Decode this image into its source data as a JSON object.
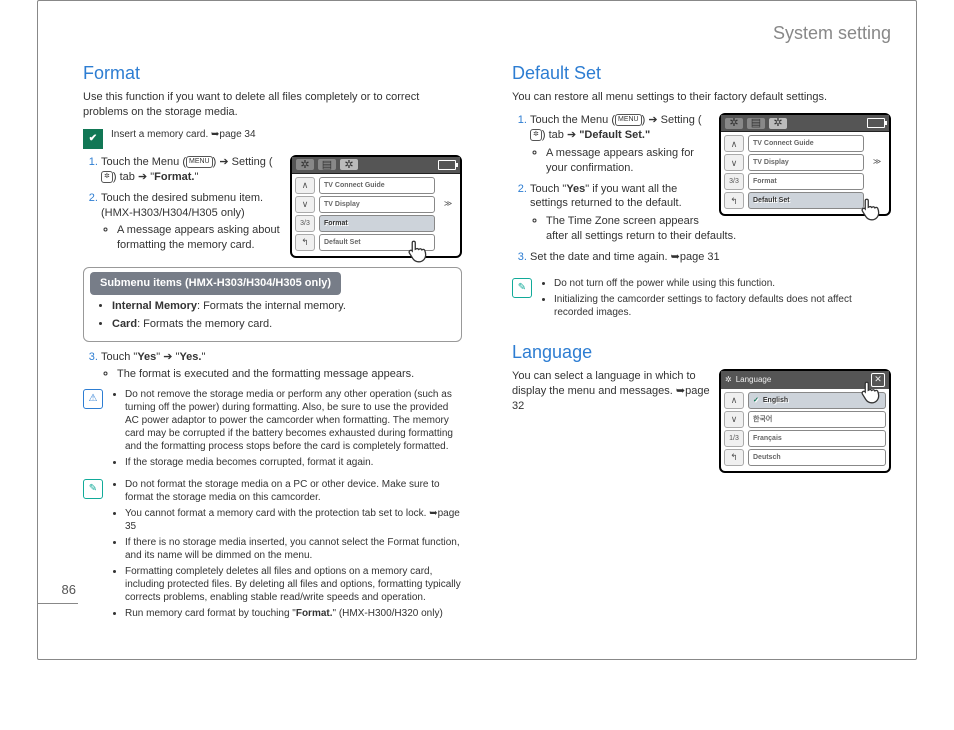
{
  "chapter_title": "System setting",
  "page_number": "86",
  "left": {
    "heading": "Format",
    "intro": "Use this function if you want to delete all files completely or to correct problems on the storage media.",
    "insert_card_note": "Insert a memory card. ➥page 34",
    "step1_a": "Touch the Menu (",
    "step1_b": ") ➔ Setting (",
    "step1_c": ") tab ➔ \"",
    "step1_bold": "Format.",
    "step1_d": "\"",
    "step2_a": "Touch the desired submenu item. (HMX-H303/H304/H305 only)",
    "step2_bullet": "A message appears asking about formatting the memory card.",
    "submenu_title": "Submenu items (HMX-H303/H304/H305 only)",
    "sub_item1_label": "Internal Memory",
    "sub_item1_text": ": Formats the internal memory.",
    "sub_item2_label": "Card",
    "sub_item2_text": ": Formats the memory card.",
    "step3_a": "Touch \"",
    "step3_b": "Yes",
    "step3_c": "\" ➔ \"",
    "step3_d": "Yes.",
    "step3_e": "\"",
    "step3_bullet": "The format is executed and the formatting message appears.",
    "warn1": "Do not remove the storage media or perform any other operation (such as turning off the power) during formatting. Also, be sure to use the provided AC power adaptor to power the camcorder when formatting. The memory card may be corrupted if the battery becomes exhausted during formatting and the formatting process stops before the card is completely formatted.",
    "warn2": "If the storage media becomes corrupted, format it again.",
    "tip1": "Do not format the storage media on a PC or other device. Make sure to format the storage media on this camcorder.",
    "tip2": "You cannot format a memory card with the protection tab set to lock. ➥page 35",
    "tip3": "If there is no storage media inserted, you cannot select the Format function, and its name will be dimmed on the menu.",
    "tip4": "Formatting completely deletes all files and options on a memory card, including protected files. By deleting all files and options, formatting typically corrects problems, enabling stable read/write speeds and operation.",
    "tip5_a": "Run memory card format by touching \"",
    "tip5_b": "Format.",
    "tip5_c": "\" (HMX-H300/H320 only)",
    "menu_chip": "MENU",
    "gear_chip": "✲",
    "ui_items": [
      "TV Connect Guide",
      "TV Display",
      "Format",
      "Default Set"
    ],
    "ui_page": "3/3",
    "ui_arrow_up": "∧",
    "ui_arrow_dn": "∨",
    "ui_back": "↰",
    "ui_more": "≫"
  },
  "right": {
    "heading1": "Default Set",
    "intro1": "You can restore all menu settings to their factory default settings.",
    "r_step1_a": "Touch the Menu (",
    "r_step1_b": ") ➔ Setting (",
    "r_step1_c": ") tab ➔ ",
    "r_step1_bold": "\"Default Set.\"",
    "r_step1_bullet": "A message appears asking for your confirmation.",
    "r_step2_a": "Touch \"",
    "r_step2_b": "Yes",
    "r_step2_c": "\" if you want all the settings returned to the default.",
    "r_step2_bullet": "The Time Zone screen appears after all settings return to their defaults.",
    "r_step3": "Set the date and time again. ➥page 31",
    "r_tip1": "Do not turn off the power while using this function.",
    "r_tip2": "Initializing the camcorder settings to factory defaults does not affect recorded images.",
    "heading2": "Language",
    "intro2": "You can select a language in which to display the menu and messages. ➥page 32",
    "ui_items": [
      "TV Connect Guide",
      "TV Display",
      "Format",
      "Default Set"
    ],
    "ui_page": "3/3",
    "lang_title": "Language",
    "lang_items": [
      "English",
      "한국어",
      "Français",
      "Deutsch"
    ],
    "lang_page": "1/3",
    "lang_close": "✕",
    "lang_check": "✓"
  }
}
